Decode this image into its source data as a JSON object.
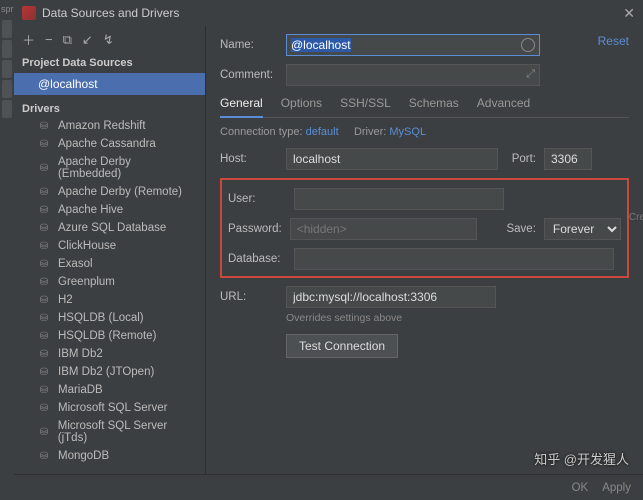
{
  "title": "Data Sources and Drivers",
  "sidebar": {
    "ds_header": "Project Data Sources",
    "ds_item": "@localhost",
    "drivers_header": "Drivers",
    "drivers": [
      "Amazon Redshift",
      "Apache Cassandra",
      "Apache Derby (Embedded)",
      "Apache Derby (Remote)",
      "Apache Hive",
      "Azure SQL Database",
      "ClickHouse",
      "Exasol",
      "Greenplum",
      "H2",
      "HSQLDB (Local)",
      "HSQLDB (Remote)",
      "IBM Db2",
      "IBM Db2 (JTOpen)",
      "MariaDB",
      "Microsoft SQL Server",
      "Microsoft SQL Server (jTds)",
      "MongoDB"
    ]
  },
  "labels": {
    "name": "Name:",
    "comment": "Comment:",
    "host": "Host:",
    "port": "Port:",
    "user": "User:",
    "password": "Password:",
    "save": "Save:",
    "database": "Database:",
    "url": "URL:",
    "hint": "Overrides settings above",
    "test": "Test Connection",
    "reset": "Reset",
    "conn_type": "Connection type:",
    "conn_type_val": "default",
    "driver": "Driver:",
    "driver_val": "MySQL"
  },
  "tabs": [
    "General",
    "Options",
    "SSH/SSL",
    "Schemas",
    "Advanced"
  ],
  "values": {
    "name": "@localhost",
    "host": "localhost",
    "port": "3306",
    "user": "",
    "password_placeholder": "<hidden>",
    "database": "",
    "save": "Forever",
    "url": "jdbc:mysql://localhost:3306"
  },
  "footer": {
    "ok": "OK",
    "apply": "Apply"
  },
  "watermark": "知乎 @开发猩人",
  "edge_text": "spr"
}
